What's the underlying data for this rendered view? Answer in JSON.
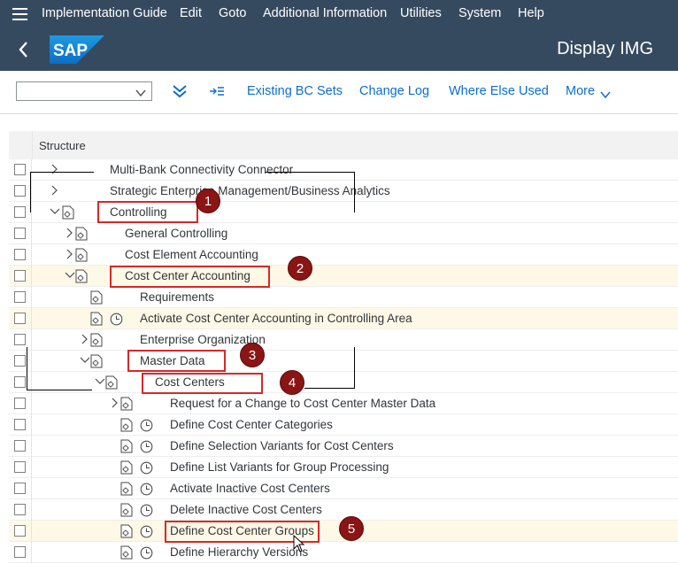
{
  "menubar": {
    "items": [
      "Implementation Guide",
      "Edit",
      "Goto",
      "Additional Information",
      "Utilities",
      "System",
      "Help"
    ]
  },
  "shell": {
    "logo": "SAP",
    "title": "Display IMG"
  },
  "toolbar": {
    "combo_value": "",
    "buttons": [
      "Existing BC Sets",
      "Change Log",
      "Where Else Used",
      "More"
    ]
  },
  "grid": {
    "header": "Structure",
    "rows": [
      {
        "text": "Multi-Bank Connectivity Connector"
      },
      {
        "text": "Strategic Enterprise Management/Business Analytics"
      },
      {
        "text": "Controlling"
      },
      {
        "text": "General Controlling"
      },
      {
        "text": "Cost Element Accounting"
      },
      {
        "text": "Cost Center Accounting"
      },
      {
        "text": "Requirements"
      },
      {
        "text": "Activate Cost Center Accounting in Controlling Area"
      },
      {
        "text": "Enterprise Organization"
      },
      {
        "text": "Master Data"
      },
      {
        "text": "Cost Centers"
      },
      {
        "text": "Request for a Change to Cost Center Master Data"
      },
      {
        "text": "Define Cost Center Categories"
      },
      {
        "text": "Define Selection Variants for Cost Centers"
      },
      {
        "text": "Define List Variants for Group Processing"
      },
      {
        "text": "Activate Inactive Cost Centers"
      },
      {
        "text": "Delete Inactive Cost Centers"
      },
      {
        "text": "Define Cost Center Groups"
      },
      {
        "text": "Define Hierarchy Versions"
      }
    ]
  },
  "annotations": {
    "badges": [
      "1",
      "2",
      "3",
      "4",
      "5"
    ]
  },
  "colors": {
    "shell": "#354a5f",
    "link": "#0a6ed1",
    "highlight_row": "#fef8e6",
    "annotation_red": "#d42a2a",
    "badge": "#8b1414"
  }
}
